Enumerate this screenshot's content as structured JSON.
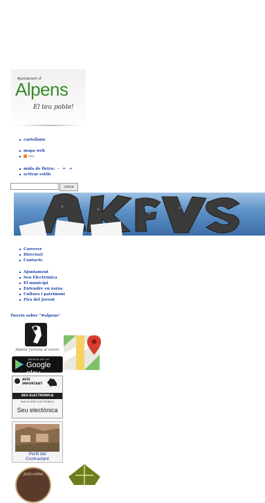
{
  "logo": {
    "prefix": "Ajuntament d'",
    "name": "Alpens",
    "tagline": "El teu poble!"
  },
  "language_links": [
    "castellano"
  ],
  "site_links": [
    {
      "label": "mapa web",
      "icon": ""
    },
    {
      "label": "rss",
      "icon": "rss-icon"
    }
  ],
  "accessibility": {
    "font_size_label": "mida de lletra:",
    "font_controls": [
      "-",
      "=",
      "+"
    ],
    "style_label": "activar estils"
  },
  "search": {
    "value": "",
    "button": "cerca"
  },
  "quick_links": [
    "Carrerer",
    "Directori",
    "Contacte"
  ],
  "main_menu": [
    "Ajuntament",
    "Seu Electrònica",
    "El municipi",
    "Entendre en xarxa",
    "Cultura i patrimoni",
    "Fira del Jovent"
  ],
  "tweets_label": "Tweets sobre \"#alpens\"",
  "badges": {
    "app_caption": "Alpens Turisme al carrer",
    "google_play": {
      "small": "ANDROID APP ON",
      "big": "Google play"
    },
    "seu": {
      "avis": "AVÍS",
      "important": "IMPORTANT",
      "band1": "SEU ELECTRÒNICA",
      "band2": "NUEVA SEDE ELECTRÓNICA",
      "label": "Seu electònica"
    },
    "perfil": {
      "line1": "Perfil del",
      "line2": "Contractant"
    },
    "bottom_seal_text": "JOVES ALPENS"
  },
  "colors": {
    "link": "#1a3fa8",
    "logo_green": "#3a8a28",
    "banner_sky": "#5f93c8"
  }
}
